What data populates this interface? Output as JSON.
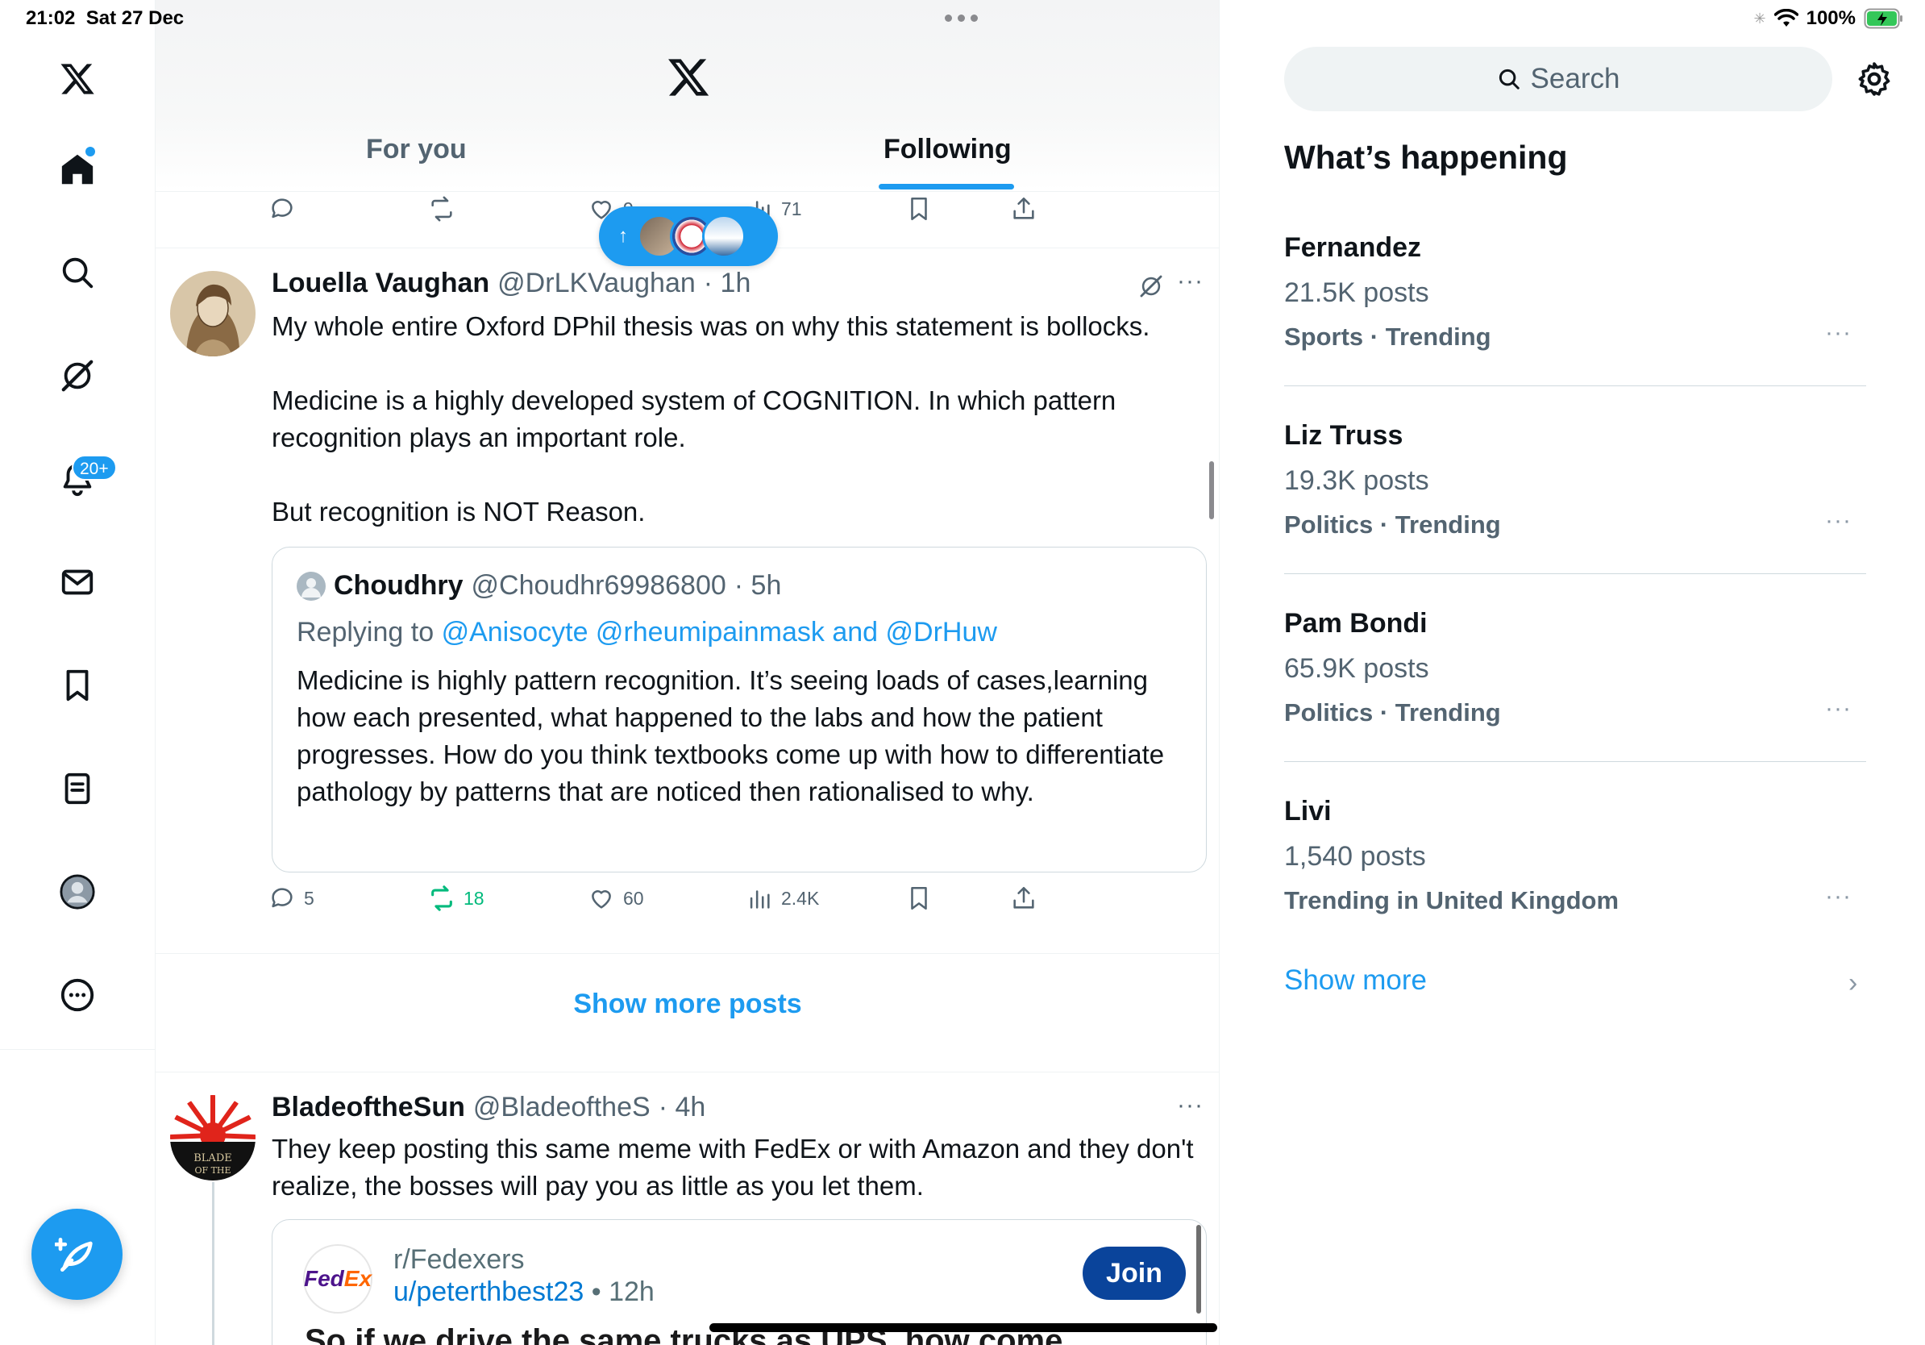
{
  "status": {
    "time": "21:02",
    "date": "Sat 27 Dec",
    "battery": "100%"
  },
  "header": {
    "tabs": [
      "For you",
      "Following"
    ],
    "active_tab": "Following"
  },
  "nav": {
    "notifications_badge": "20+"
  },
  "prev_post_actions": {
    "likes": "9",
    "views": "71"
  },
  "post1": {
    "name": "Louella Vaughan",
    "handle": "@DrLKVaughan",
    "time": "· 1h",
    "text": "My whole entire Oxford DPhil thesis was on why this statement is bollocks.\n\nMedicine is a highly developed system of COGNITION. In which pattern recognition plays an important role.\n\nBut recognition is NOT Reason.",
    "quote": {
      "name": "Choudhry",
      "handle": "@Choudhr69986800",
      "time": "· 5h",
      "replying_prefix": "Replying to",
      "replying_links": "@Anisocyte @rheumipainmask and @DrHuw",
      "text": "Medicine is highly pattern recognition. It’s seeing loads of cases,learning how each presented, what happened to the labs and how the patient progresses. How do you think textbooks come up with how to differentiate pathology by patterns that are noticed then rationalised to why."
    },
    "actions": {
      "replies": "5",
      "reposts": "18",
      "likes": "60",
      "views": "2.4K"
    }
  },
  "show_more_posts": "Show more posts",
  "post2": {
    "name": "BladeoftheSun",
    "handle": "@BladeoftheS",
    "time": "· 4h",
    "text": "They keep posting this same meme with FedEx or with Amazon and they don't realize, the bosses will pay you as little as you let them.",
    "embed": {
      "logo_fed": "Fed",
      "logo_ex": "Ex",
      "subreddit": "r/Fedexers",
      "user": "u/peterthbest23",
      "time": "• 12h",
      "join": "Join",
      "title_cut": "So if we drive the same trucks as UPS, how come"
    }
  },
  "sidebar": {
    "search_placeholder": "Search",
    "title": "What’s happening",
    "trends": [
      {
        "name": "Fernandez",
        "count": "21.5K posts",
        "category": "Sports · Trending"
      },
      {
        "name": "Liz Truss",
        "count": "19.3K posts",
        "category": "Politics · Trending"
      },
      {
        "name": "Pam Bondi",
        "count": "65.9K posts",
        "category": "Politics · Trending"
      },
      {
        "name": "Livi",
        "count": "1,540 posts",
        "category": "Trending in United Kingdom"
      }
    ],
    "show_more": "Show more"
  },
  "colors": {
    "accent": "#1d9bf0",
    "repost_green": "#00ba7c",
    "secondary_text": "#536471"
  }
}
